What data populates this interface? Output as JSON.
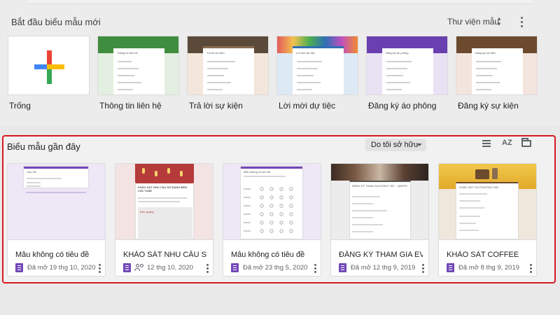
{
  "gallery": {
    "title": "Bắt đầu biểu mẫu mới",
    "library_label": "Thư viện mẫu",
    "templates": [
      {
        "label": "Trống"
      },
      {
        "label": "Thông tin liên hệ",
        "accent": "#3f8d3f"
      },
      {
        "label": "Trả lời sự kiện",
        "accent": "#5b4a3a"
      },
      {
        "label": "Lời mời dự tiệc",
        "accent": "#2f6fb5"
      },
      {
        "label": "Đăng ký áo phông",
        "accent": "#6a3fb0"
      },
      {
        "label": "Đăng ký sự kiện",
        "accent": "#6b4a2e"
      }
    ],
    "template_thumb_texts": [
      "Thông tin liên hệ",
      "Trả lời sự kiện",
      "Lời mời dự tiệc",
      "Đăng ký áo phông",
      "Đăng ký sự kiện"
    ]
  },
  "recent": {
    "title": "Biểu mẫu gần đây",
    "owner_filter": "Do tôi sở hữu",
    "sort_icon_text": "AZ",
    "cards": [
      {
        "title": "Mẫu không có tiêu đề",
        "meta": "Đã mở 19 thg 10, 2020",
        "shared": false,
        "thumb_title": "Câu hỏi",
        "thumb_text": "Câu hỏi không có tiêu đề"
      },
      {
        "title": "KHẢO SÁT NHU CẦU SỬ D...",
        "meta": "12 thg 10, 2020",
        "shared": true,
        "thumb_title": "KHẢO SÁT NHU CẦU SỬ DỤNG ĐÈN LED TUBE",
        "thumb_text": "Đèn quang"
      },
      {
        "title": "Mẫu không có tiêu đề",
        "meta": "Đã mở 23 thg 5, 2020",
        "shared": false,
        "thumb_title": "Mẫu không có tiêu đề",
        "thumb_text": ""
      },
      {
        "title": "ĐĂNG KÝ THAM GIA EVE...",
        "meta": "Đã mở 12 thg 9, 2019",
        "shared": false,
        "thumb_title": "ĐĂNG KÝ THAM GIA EVENT \"IIE\" - IQHPIO",
        "thumb_text": ""
      },
      {
        "title": "KHẢO SÁT COFFEE",
        "meta": "Đã mở 8 thg 9, 2019",
        "shared": false,
        "thumb_title": "KHẢO SÁT THỊ TRƯỜNG F&B",
        "thumb_text": ""
      }
    ]
  },
  "colors": {
    "forms_purple": "#7248b9",
    "highlight_border": "#d71920"
  }
}
